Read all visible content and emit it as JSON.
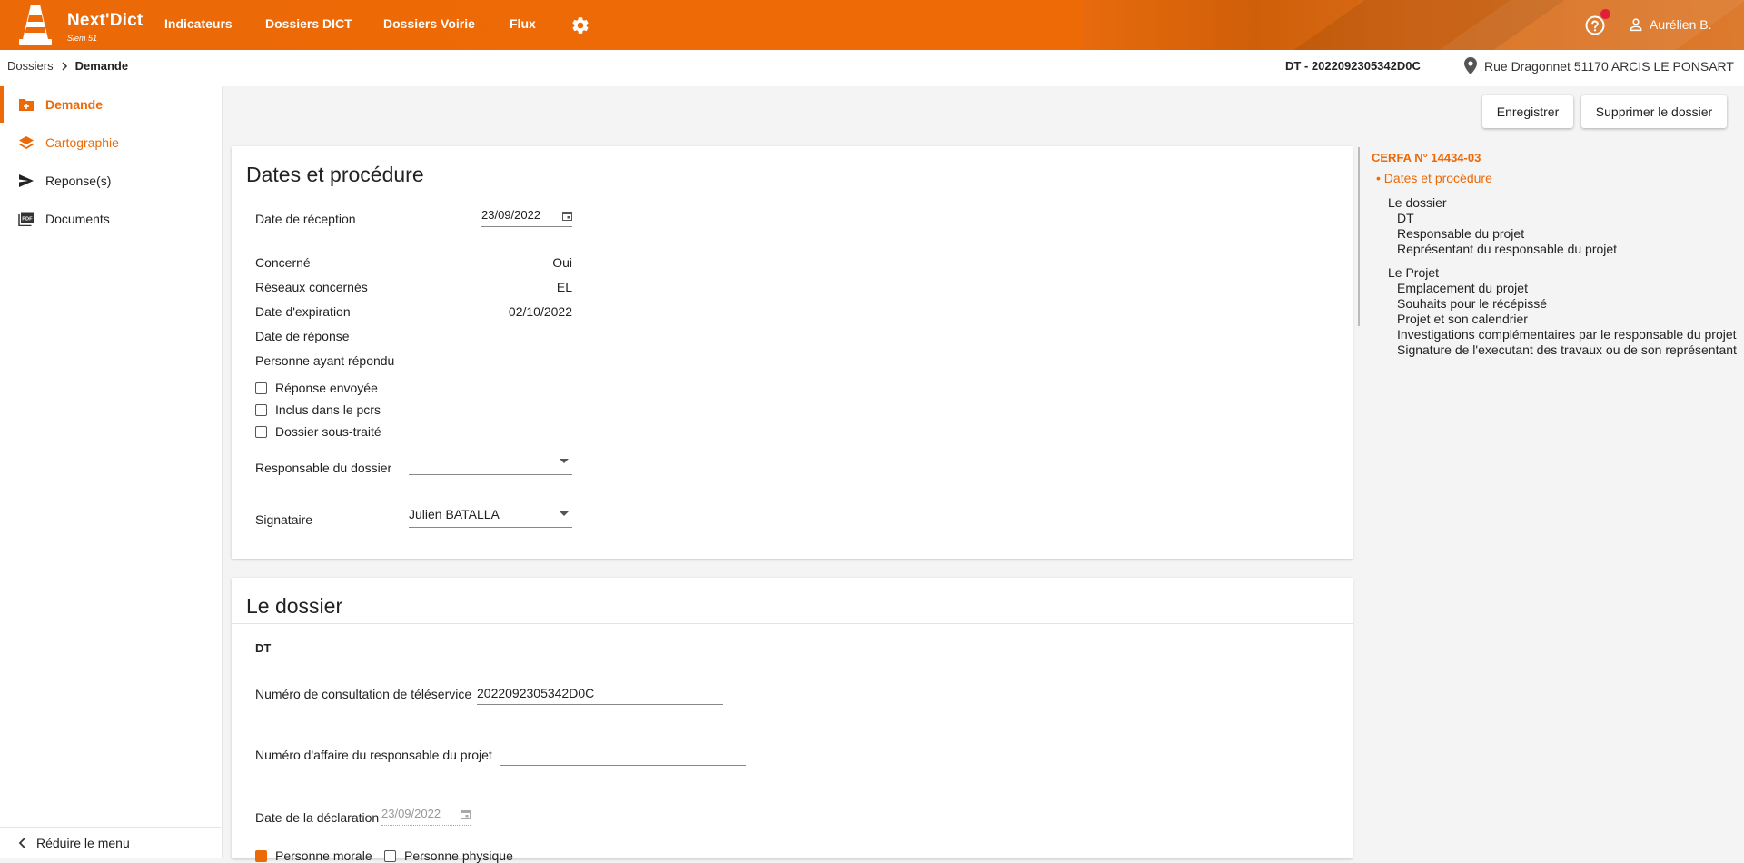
{
  "app": {
    "name": "Next'Dict",
    "subtitle": "Siem 51",
    "nav": [
      "Indicateurs",
      "Dossiers DICT",
      "Dossiers Voirie",
      "Flux"
    ],
    "user": "Aurélien B.",
    "accent_color": "#ec6907"
  },
  "breadcrumb": {
    "root": "Dossiers",
    "current": "Demande"
  },
  "header": {
    "dt_ref": "DT - 2022092305342D0C",
    "address": "Rue Dragonnet 51170 ARCIS LE PONSART"
  },
  "sidebar": {
    "items": [
      {
        "label": "Demande",
        "icon": "folder-plus-icon"
      },
      {
        "label": "Cartographie",
        "icon": "layers-icon"
      },
      {
        "label": "Reponse(s)",
        "icon": "send-icon"
      },
      {
        "label": "Documents",
        "icon": "pdf-icon"
      }
    ],
    "collapse_label": "Réduire le menu"
  },
  "actions": {
    "save": "Enregistrer",
    "delete": "Supprimer le dossier"
  },
  "dates": {
    "title": "Dates et procédure",
    "reception_label": "Date de réception",
    "reception_value": "23/09/2022",
    "concerne_label": "Concerné",
    "concerne_value": "Oui",
    "reseaux_label": "Réseaux concernés",
    "reseaux_value": "EL",
    "expiration_label": "Date d'expiration",
    "expiration_value": "02/10/2022",
    "reponse_label": "Date de réponse",
    "personne_label": "Personne ayant répondu",
    "checkboxes": [
      {
        "label": "Réponse envoyée",
        "checked": false
      },
      {
        "label": "Inclus dans le pcrs",
        "checked": false
      },
      {
        "label": "Dossier sous-traité",
        "checked": false
      }
    ],
    "responsable_label": "Responsable du dossier",
    "responsable_value": "",
    "signataire_label": "Signataire",
    "signataire_value": "Julien BATALLA"
  },
  "dossier": {
    "title": "Le dossier",
    "section": "DT",
    "consultation_label": "Numéro de consultation de téléservice",
    "consultation_value": "2022092305342D0C",
    "affaire_label": "Numéro d'affaire du responsable du projet",
    "affaire_value": "",
    "declaration_label": "Date de la déclaration",
    "declaration_value": "23/09/2022",
    "personne_morale": "Personne morale",
    "personne_physique": "Personne physique"
  },
  "toc": {
    "cerfa": "CERFA N° 14434-03",
    "active": "Dates et procédure",
    "group1": "Le dossier",
    "group1_items": [
      "DT",
      "Responsable du projet",
      "Représentant du responsable du projet"
    ],
    "group2": "Le Projet",
    "group2_items": [
      "Emplacement du projet",
      "Souhaits pour le récépissé",
      "Projet et son calendrier",
      "Investigations complémentaires par le responsable du projet",
      "Signature de l'executant des travaux ou de son représentant"
    ]
  }
}
